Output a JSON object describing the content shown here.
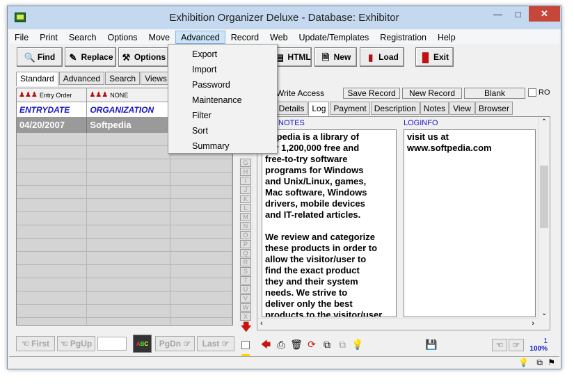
{
  "window": {
    "title": "Exhibition Organizer Deluxe - Database: Exhibitor"
  },
  "menu": [
    "File",
    "Print",
    "Search",
    "Options",
    "Move",
    "Advanced",
    "Record",
    "Web",
    "Update/Templates",
    "Registration",
    "Help"
  ],
  "advanced_menu": [
    "Export",
    "Import",
    "Password",
    "Maintenance",
    "Filter",
    "Sort",
    "Summary"
  ],
  "toolbar": {
    "find": "Find",
    "replace": "Replace",
    "options": "Options",
    "html": "HTML",
    "new": "New",
    "load": "Load",
    "exit": "Exit"
  },
  "left_tabs": [
    "Standard",
    "Advanced",
    "Search",
    "Views"
  ],
  "sort": {
    "first": "Entry Order",
    "second": "NONE"
  },
  "grid": {
    "columns": [
      "ENTRYDATE",
      "ORGANIZATION"
    ],
    "rows": [
      [
        "04/20/2007",
        "Softpedia"
      ]
    ]
  },
  "alpha": [
    "G",
    "H",
    "I",
    "J",
    "K",
    "L",
    "M",
    "N",
    "O",
    "P",
    "Q",
    "R",
    "S",
    "T",
    "U",
    "V",
    "W",
    "X"
  ],
  "nav": {
    "first": "First",
    "pgup": "PgUp",
    "pgdn": "PgDn",
    "last": "Last"
  },
  "record_bar": {
    "write_access": "Write Access",
    "save": "Save Record",
    "new": "New Record",
    "blank": "Blank",
    "ro": "RO"
  },
  "right_tabs": [
    "itor",
    "Details",
    "Log",
    "Payment",
    "Description",
    "Notes",
    "View",
    "Browser"
  ],
  "fields": {
    "notes_label": "NOTES",
    "notes": "oftpedia is a library of\nver 1,200,000 free and\nfree-to-try software\nprograms for Windows\nand Unix/Linux, games,\nMac software, Windows\ndrivers, mobile devices\nand IT-related articles.\n\nWe review and categorize\nthese products in order to\nallow the visitor/user to\nfind the exact product\nthey and their system\nneeds. We strive to\ndeliver only the best\nproducts to the visitor/user",
    "loginfo_label": "LOGINFO",
    "loginfo": "visit us at\nwww.softpedia.com"
  },
  "status": {
    "record": "1",
    "percent": "100%"
  }
}
